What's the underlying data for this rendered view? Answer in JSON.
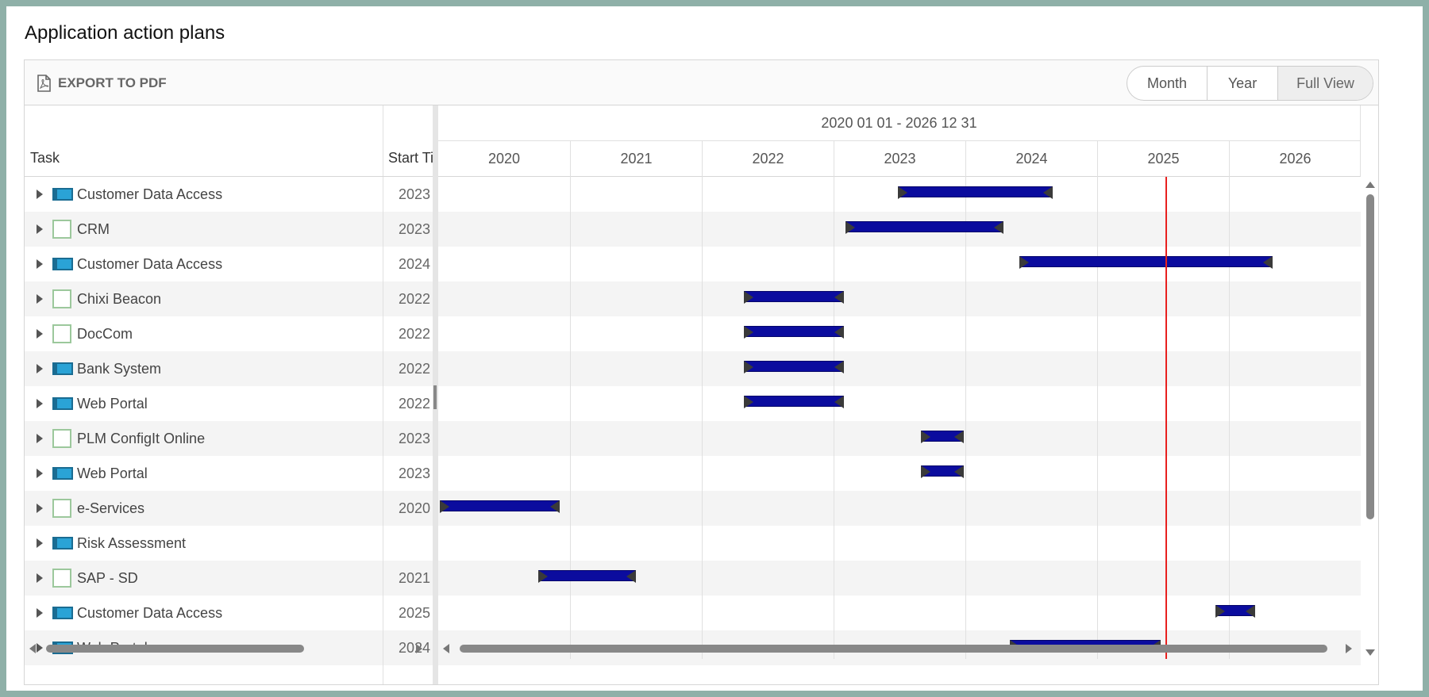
{
  "page": {
    "title": "Application action plans"
  },
  "toolbar": {
    "export_label": "EXPORT TO PDF",
    "views": [
      "Month",
      "Year",
      "Full View"
    ],
    "active_view": "Full View"
  },
  "grid": {
    "columns": {
      "task": "Task",
      "start": "Start Time"
    },
    "rows": [
      {
        "name": "Customer Data Access",
        "icon": "application-icon",
        "start": "2023 01 01"
      },
      {
        "name": "CRM",
        "icon": "checkbox-icon",
        "start": "2023 01 01"
      },
      {
        "name": "Customer Data Access",
        "icon": "application-icon",
        "start": "2024 01 01"
      },
      {
        "name": "Chixi Beacon",
        "icon": "checkbox-icon",
        "start": "2022 01 01"
      },
      {
        "name": "DocCom",
        "icon": "checkbox-icon",
        "start": "2022 01 01"
      },
      {
        "name": "Bank System",
        "icon": "application-icon",
        "start": "2022 01 01"
      },
      {
        "name": "Web Portal",
        "icon": "application-icon",
        "start": "2022 01 01"
      },
      {
        "name": "PLM ConfigIt Online",
        "icon": "checkbox-icon",
        "start": "2023 01 01"
      },
      {
        "name": "Web Portal",
        "icon": "application-icon",
        "start": "2023 01 01"
      },
      {
        "name": "e-Services",
        "icon": "checkbox-icon",
        "start": "2020 01 01"
      },
      {
        "name": "Risk Assessment",
        "icon": "application-icon",
        "start": ""
      },
      {
        "name": "SAP - SD",
        "icon": "checkbox-icon",
        "start": "2021 01 01"
      },
      {
        "name": "Customer Data Access",
        "icon": "application-icon",
        "start": "2025 10 01"
      },
      {
        "name": "Web Portal",
        "icon": "application-icon",
        "start": "2024 01 01"
      }
    ]
  },
  "timeline": {
    "range_label": "2020 01 01 - 2026 12 31",
    "years": [
      "2020",
      "2021",
      "2022",
      "2023",
      "2024",
      "2025",
      "2026"
    ],
    "today": 2025.52,
    "bars": [
      {
        "row": 0,
        "start": 2023.49,
        "end": 2024.66
      },
      {
        "row": 1,
        "start": 2023.09,
        "end": 2024.29
      },
      {
        "row": 2,
        "start": 2024.41,
        "end": 2026.33
      },
      {
        "row": 3,
        "start": 2022.32,
        "end": 2023.08
      },
      {
        "row": 4,
        "start": 2022.32,
        "end": 2023.08
      },
      {
        "row": 5,
        "start": 2022.32,
        "end": 2023.08
      },
      {
        "row": 6,
        "start": 2022.32,
        "end": 2023.08
      },
      {
        "row": 7,
        "start": 2023.66,
        "end": 2023.99
      },
      {
        "row": 8,
        "start": 2023.66,
        "end": 2023.99
      },
      {
        "row": 9,
        "start": 2020.01,
        "end": 2020.92
      },
      {
        "row": 11,
        "start": 2020.76,
        "end": 2021.5
      },
      {
        "row": 12,
        "start": 2025.9,
        "end": 2026.2
      },
      {
        "row": 13,
        "start": 2024.34,
        "end": 2025.48
      }
    ]
  }
}
